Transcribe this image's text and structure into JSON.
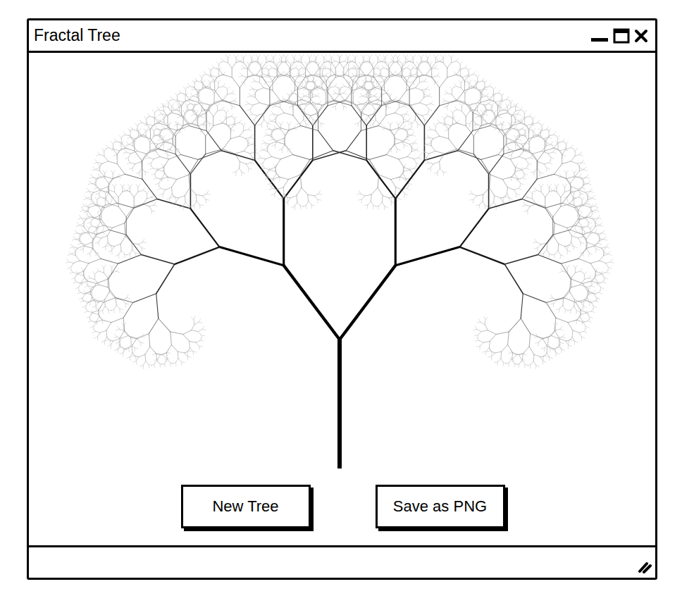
{
  "window": {
    "title": "Fractal Tree"
  },
  "buttons": [
    "New Tree",
    "Save as PNG"
  ]
}
